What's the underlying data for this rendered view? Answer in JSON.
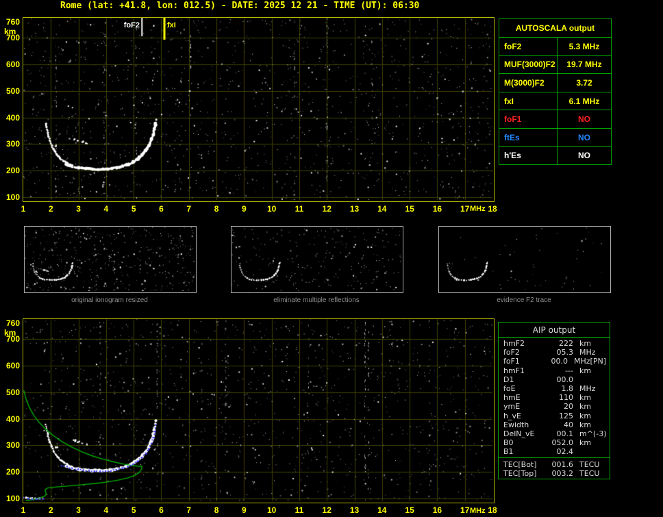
{
  "title": "Rome (lat: +41.8, lon: 012.5) - DATE: 2025 12 21 - TIME (UT): 06:30",
  "colors": {
    "background": "#000000",
    "title_text": "#ffff00",
    "plot_border": "#b8b800",
    "grid_line": "#404000",
    "tick_label": "#ffff00",
    "trace_white": "#ffffff",
    "profile_green": "#00b000",
    "restored_blue": "#3a3aff",
    "marker_foF2": "#ffffff",
    "marker_fxI": "#ffff00",
    "table_border_green": "#00a800",
    "caption_gray": "#8f8f8f",
    "aip_text": "#dcdcdc",
    "value_red": "#ff2222",
    "value_blue": "#2288ff"
  },
  "top_plot": {
    "foF2_label": "foF2",
    "fxI_label": "fxI",
    "y_unit": "km",
    "x_unit": "MHz"
  },
  "bottom_plot": {
    "y_unit": "km",
    "x_unit": "MHz"
  },
  "autoscala": {
    "title": "AUTOSCALA output",
    "rows": [
      {
        "param": "foF2",
        "value": "5.3 MHz",
        "color": "yellow"
      },
      {
        "param": "MUF(3000)F2",
        "value": "19.7 MHz",
        "color": "yellow"
      },
      {
        "param": "M(3000)F2",
        "value": "3.72",
        "color": "yellow"
      },
      {
        "param": "fxI",
        "value": "6.1 MHz",
        "color": "yellow"
      },
      {
        "param": "foF1",
        "value": "NO",
        "color": "red"
      },
      {
        "param": "ftEs",
        "value": "NO",
        "color": "blue"
      },
      {
        "param": "h'Es",
        "value": "NO",
        "color": "white"
      }
    ]
  },
  "process_panels": [
    {
      "caption": "original ionogram resized"
    },
    {
      "caption": "eliminate multiple reflections"
    },
    {
      "caption": "evidence F2 trace"
    }
  ],
  "aip": {
    "title": "AIP output",
    "rows": [
      {
        "param": "hmF2",
        "value": "222",
        "unit": "km",
        "note": ""
      },
      {
        "param": "foF2",
        "value": "05.3",
        "unit": "MHz",
        "note": ""
      },
      {
        "param": "foF1",
        "value": "00.0",
        "unit": "MHz",
        "note": "[PN]"
      },
      {
        "param": "hmF1",
        "value": "---",
        "unit": "km",
        "note": ""
      },
      {
        "param": "D1",
        "value": "00.0",
        "unit": "",
        "note": ""
      },
      {
        "param": "foE",
        "value": "1.8",
        "unit": "MHz",
        "note": ""
      },
      {
        "param": "hmE",
        "value": "110",
        "unit": "km",
        "note": ""
      },
      {
        "param": "ymE",
        "value": "20",
        "unit": "km",
        "note": ""
      },
      {
        "param": "h_vE",
        "value": "125",
        "unit": "km",
        "note": ""
      },
      {
        "param": "Ewidth",
        "value": "40",
        "unit": "km",
        "note": ""
      },
      {
        "param": "DelN_vE",
        "value": "00.1",
        "unit": "m^(-3)",
        "note": ""
      },
      {
        "param": "B0",
        "value": "052.0",
        "unit": "km",
        "note": ""
      },
      {
        "param": "B1",
        "value": "02.4",
        "unit": "",
        "note": ""
      }
    ],
    "tec_rows": [
      {
        "param": "TEC[Bot]",
        "value": "001.6",
        "unit": "TECU"
      },
      {
        "param": "TEC[Top]",
        "value": "003.2",
        "unit": "TECU"
      }
    ]
  },
  "chart_data": [
    {
      "id": "main_ionogram",
      "type": "scatter",
      "title": "Recorded ionogram with AUTOSCALA markers",
      "xlabel": "MHz",
      "ylabel": "km",
      "xlim": [
        1,
        18
      ],
      "ylim": [
        90,
        775
      ],
      "x_ticks": [
        1,
        2,
        3,
        4,
        5,
        6,
        7,
        8,
        9,
        10,
        11,
        12,
        13,
        14,
        15,
        16,
        17,
        18
      ],
      "y_ticks": [
        100,
        200,
        300,
        400,
        500,
        600,
        700,
        760
      ],
      "grid": true,
      "markers": {
        "foF2_MHz": 5.3,
        "fxI_MHz": 6.1
      },
      "series": [
        {
          "name": "F2_trace_cusp",
          "points": [
            [
              1.82,
              378
            ],
            [
              1.86,
              356
            ],
            [
              1.9,
              335
            ],
            [
              1.96,
              314
            ],
            [
              2.03,
              295
            ],
            [
              2.11,
              277
            ],
            [
              2.21,
              261
            ],
            [
              2.33,
              247
            ],
            [
              2.47,
              236
            ],
            [
              2.62,
              227
            ],
            [
              2.78,
              220
            ]
          ]
        },
        {
          "name": "F2_trace_main",
          "points": [
            [
              2.55,
              223
            ],
            [
              2.78,
              215
            ],
            [
              3.0,
              211
            ],
            [
              3.25,
              208
            ],
            [
              3.5,
              206
            ],
            [
              3.75,
              205
            ],
            [
              4.0,
              206
            ],
            [
              4.2,
              208
            ],
            [
              4.4,
              212
            ],
            [
              4.6,
              217
            ],
            [
              4.8,
              224
            ],
            [
              5.0,
              234
            ],
            [
              5.15,
              245
            ],
            [
              5.3,
              259
            ],
            [
              5.43,
              275
            ],
            [
              5.54,
              293
            ],
            [
              5.63,
              313
            ],
            [
              5.7,
              335
            ],
            [
              5.75,
              357
            ],
            [
              5.79,
              380
            ],
            [
              5.81,
              392
            ]
          ]
        },
        {
          "name": "trace_fragments",
          "points": [
            [
              2.86,
              318
            ],
            [
              3.0,
              313
            ],
            [
              3.14,
              308
            ],
            [
              3.28,
              304
            ],
            [
              2.2,
              294
            ]
          ]
        }
      ]
    },
    {
      "id": "profile_ionogram",
      "type": "scatter",
      "title": "Ionogram with restored trace and electron density profile",
      "xlabel": "MHz",
      "ylabel": "km",
      "xlim": [
        1,
        18
      ],
      "ylim": [
        90,
        775
      ],
      "x_ticks": [
        1,
        2,
        3,
        4,
        5,
        6,
        7,
        8,
        9,
        10,
        11,
        12,
        13,
        14,
        15,
        16,
        17,
        18
      ],
      "y_ticks": [
        100,
        200,
        300,
        400,
        500,
        600,
        700,
        760
      ],
      "grid": true,
      "series": [
        {
          "name": "F2_trace_cusp",
          "points": [
            [
              1.82,
              378
            ],
            [
              1.86,
              356
            ],
            [
              1.9,
              335
            ],
            [
              1.96,
              314
            ],
            [
              2.03,
              295
            ],
            [
              2.11,
              277
            ],
            [
              2.21,
              261
            ],
            [
              2.33,
              247
            ],
            [
              2.47,
              236
            ],
            [
              2.62,
              227
            ],
            [
              2.78,
              220
            ]
          ]
        },
        {
          "name": "F2_trace_main",
          "points": [
            [
              2.55,
              223
            ],
            [
              2.78,
              215
            ],
            [
              3.0,
              211
            ],
            [
              3.25,
              208
            ],
            [
              3.5,
              206
            ],
            [
              3.75,
              205
            ],
            [
              4.0,
              206
            ],
            [
              4.2,
              208
            ],
            [
              4.4,
              212
            ],
            [
              4.6,
              217
            ],
            [
              4.8,
              224
            ],
            [
              5.0,
              234
            ],
            [
              5.15,
              245
            ],
            [
              5.3,
              259
            ],
            [
              5.43,
              275
            ],
            [
              5.54,
              293
            ],
            [
              5.63,
              313
            ],
            [
              5.7,
              335
            ],
            [
              5.75,
              357
            ],
            [
              5.79,
              380
            ],
            [
              5.81,
              392
            ]
          ]
        },
        {
          "name": "trace_fragments",
          "points": [
            [
              2.86,
              318
            ],
            [
              3.0,
              313
            ],
            [
              3.14,
              308
            ],
            [
              3.28,
              304
            ],
            [
              2.2,
              294
            ]
          ]
        },
        {
          "name": "E_trace_white",
          "points": [
            [
              0.98,
              105
            ],
            [
              1.1,
              103
            ],
            [
              1.25,
              101
            ],
            [
              1.42,
              100
            ],
            [
              1.58,
              100
            ],
            [
              1.7,
              102
            ]
          ]
        },
        {
          "name": "electron_density_profile",
          "color": "green",
          "points": [
            [
              1.02,
              507
            ],
            [
              1.1,
              474
            ],
            [
              1.22,
              443
            ],
            [
              1.38,
              413
            ],
            [
              1.58,
              386
            ],
            [
              1.82,
              360
            ],
            [
              2.1,
              336
            ],
            [
              2.42,
              313
            ],
            [
              2.77,
              293
            ],
            [
              3.14,
              275
            ],
            [
              3.52,
              260
            ],
            [
              3.9,
              248
            ],
            [
              4.28,
              238
            ],
            [
              4.62,
              230
            ],
            [
              4.92,
              225
            ],
            [
              5.16,
              222
            ],
            [
              5.3,
              222
            ],
            [
              5.28,
              209
            ],
            [
              5.19,
              197
            ],
            [
              5.03,
              187
            ],
            [
              4.79,
              178
            ],
            [
              4.47,
              170
            ],
            [
              4.08,
              163
            ],
            [
              3.62,
              157
            ],
            [
              3.12,
              152
            ],
            [
              2.6,
              147
            ],
            [
              2.12,
              143
            ],
            [
              1.88,
              140
            ],
            [
              1.79,
              133
            ],
            [
              1.81,
              124
            ],
            [
              1.83,
              116
            ],
            [
              1.77,
              109
            ],
            [
              1.58,
              102
            ],
            [
              1.32,
              96
            ],
            [
              1.08,
              91
            ]
          ]
        },
        {
          "name": "restored_trace",
          "color": "blue",
          "points": [
            [
              2.35,
              228
            ],
            [
              2.55,
              222
            ],
            [
              2.75,
              216
            ],
            [
              2.95,
              212
            ],
            [
              3.15,
              209
            ],
            [
              3.35,
              207
            ],
            [
              3.55,
              205
            ],
            [
              3.75,
              205
            ],
            [
              3.95,
              206
            ],
            [
              4.15,
              208
            ],
            [
              4.35,
              212
            ],
            [
              4.55,
              217
            ],
            [
              4.75,
              223
            ],
            [
              4.95,
              232
            ],
            [
              5.12,
              243
            ],
            [
              5.28,
              257
            ],
            [
              5.42,
              273
            ],
            [
              5.53,
              291
            ],
            [
              5.62,
              311
            ],
            [
              5.69,
              333
            ],
            [
              5.74,
              356
            ],
            [
              5.78,
              378
            ]
          ]
        },
        {
          "name": "restored_E_trace",
          "color": "blue",
          "points": [
            [
              1.0,
              104
            ],
            [
              1.15,
              102
            ],
            [
              1.3,
              101
            ],
            [
              1.45,
              100
            ],
            [
              1.6,
              100
            ],
            [
              1.72,
              101
            ]
          ]
        }
      ]
    },
    {
      "id": "mini_original",
      "type": "scatter",
      "title": "original ionogram resized",
      "xlim": [
        1,
        18
      ],
      "ylim": [
        90,
        775
      ],
      "series_from": "main_ionogram",
      "noise_level": "high"
    },
    {
      "id": "mini_cleaned",
      "type": "scatter",
      "title": "eliminate multiple reflections",
      "xlim": [
        1,
        18
      ],
      "ylim": [
        90,
        775
      ],
      "series_from": "main_ionogram",
      "noise_level": "medium"
    },
    {
      "id": "mini_f2",
      "type": "scatter",
      "title": "evidence F2 trace",
      "xlim": [
        1,
        18
      ],
      "ylim": [
        90,
        775
      ],
      "series_from": "main_ionogram",
      "noise_level": "low"
    }
  ]
}
